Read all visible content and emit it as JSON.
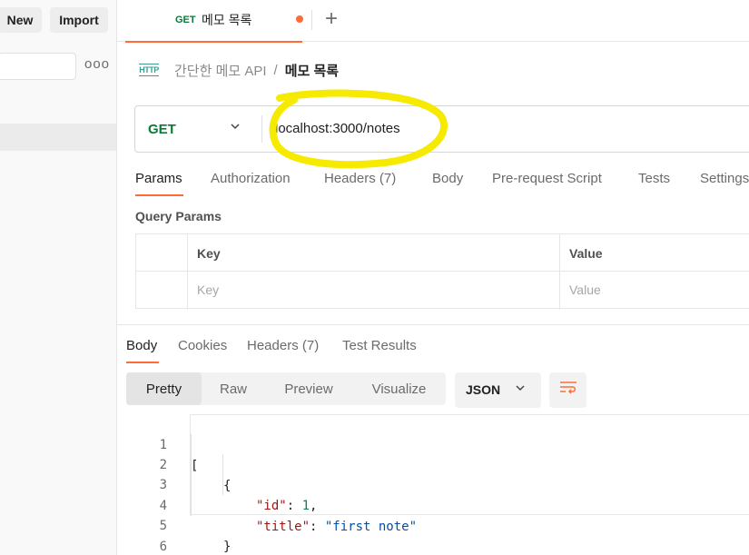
{
  "sidebar": {
    "new_label": "New",
    "import_label": "Import",
    "more_label": "ooo"
  },
  "tab": {
    "method": "GET",
    "label": "메모 목록",
    "add_label": "+"
  },
  "breadcrumb": {
    "icon_text": "HTTP",
    "parent": "간단한 메모 API",
    "separator": "/",
    "current": "메모 목록"
  },
  "request": {
    "method": "GET",
    "url": "localhost:3000/notes",
    "tabs": [
      {
        "label": "Params"
      },
      {
        "label": "Authorization"
      },
      {
        "label": "Headers (7)"
      },
      {
        "label": "Body"
      },
      {
        "label": "Pre-request Script"
      },
      {
        "label": "Tests"
      },
      {
        "label": "Settings"
      }
    ]
  },
  "query_params": {
    "title": "Query Params",
    "headers": {
      "key": "Key",
      "value": "Value"
    },
    "placeholder_key": "Key",
    "placeholder_value": "Value"
  },
  "response": {
    "tabs": [
      {
        "label": "Body"
      },
      {
        "label": "Cookies"
      },
      {
        "label": "Headers (7)"
      },
      {
        "label": "Test Results"
      }
    ],
    "view_modes": [
      {
        "label": "Pretty"
      },
      {
        "label": "Raw"
      },
      {
        "label": "Preview"
      },
      {
        "label": "Visualize"
      }
    ],
    "format": "JSON",
    "lines": [
      {
        "num": "1",
        "text": "["
      },
      {
        "num": "2",
        "text": "{"
      },
      {
        "num": "3",
        "key": "\"id\"",
        "value": "1",
        "trail": ","
      },
      {
        "num": "4",
        "key": "\"title\"",
        "value": "\"first note\"",
        "trail": ""
      },
      {
        "num": "5",
        "text": "}"
      },
      {
        "num": "6",
        "text": "]"
      }
    ]
  },
  "colors": {
    "accent": "#ff6c37",
    "method_get": "#0b7a39",
    "highlight": "#f5ea00"
  }
}
